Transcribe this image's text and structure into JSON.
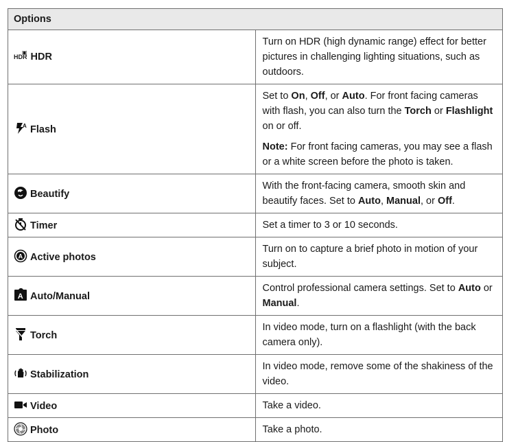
{
  "header": "Options",
  "rows": [
    {
      "name": "HDR",
      "icon": "hdr-icon",
      "icon_text": "HDR",
      "desc": "Turn on HDR (high dynamic range) effect for better pictures in challenging lighting situations, such as outdoors."
    },
    {
      "name": "Flash",
      "icon": "flash-auto-icon",
      "desc_parts": [
        "Set to ",
        "On",
        ", ",
        "Off",
        ", or ",
        "Auto",
        ". For front facing cameras with flash, you can also turn the ",
        "Torch",
        " or ",
        "Flashlight",
        " on or off."
      ],
      "note_label": "Note:",
      "note_text": " For front facing cameras, you may see a flash or a white screen before the photo is taken."
    },
    {
      "name": "Beautify",
      "icon": "beautify-face-icon",
      "desc_parts": [
        "With the front-facing camera, smooth skin and beautify faces. Set to ",
        "Auto",
        ", ",
        "Manual",
        ", or ",
        "Off",
        "."
      ]
    },
    {
      "name": "Timer",
      "icon": "timer-icon",
      "desc": "Set a timer to 3 or 10 seconds."
    },
    {
      "name": "Active photos",
      "icon": "active-photos-icon",
      "desc": "Turn on to capture a brief photo in motion of your subject."
    },
    {
      "name": "Auto/Manual",
      "icon": "manual-mode-icon",
      "icon_text": "A",
      "desc_parts": [
        "Control professional camera settings. Set to ",
        "Auto",
        " or ",
        "Manual",
        "."
      ]
    },
    {
      "name": "Torch",
      "icon": "torch-icon",
      "desc": "In video mode, turn on a flashlight (with the back camera only)."
    },
    {
      "name": "Stabilization",
      "icon": "stabilization-icon",
      "desc": "In video mode, remove some of the shakiness of the video."
    },
    {
      "name": "Video",
      "icon": "video-camera-icon",
      "desc": "Take a video."
    },
    {
      "name": "Photo",
      "icon": "shutter-icon",
      "desc": "Take a photo."
    }
  ]
}
